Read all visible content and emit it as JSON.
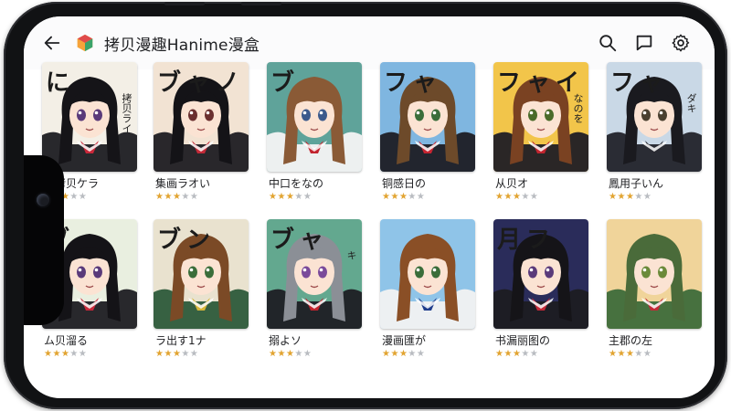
{
  "app": {
    "title": "拷贝漫趣Hanime漫盒",
    "icons": {
      "back": "arrow-left-icon",
      "logo": "cube-logo-icon",
      "search": "search-icon",
      "feedback": "feedback-icon",
      "settings": "gear-icon"
    }
  },
  "colors": {
    "star_on": "#e2a431",
    "star_off": "#b9bcc1"
  },
  "comics": [
    {
      "title": "栫拷贝ケラ",
      "rating": 3,
      "cover_text": "に",
      "side_text": "拷贝ライ",
      "bg": "#f3efe6",
      "hair": "#151418",
      "eyes": "#5a3a7a",
      "outfit": "#1c1c22",
      "accent": "#c9283a"
    },
    {
      "title": "集画ラオい",
      "rating": 3,
      "cover_text": "ブャノ",
      "side_text": "",
      "bg": "#f2e3d3",
      "hair": "#141317",
      "eyes": "#6b2f2f",
      "outfit": "#1e1c22",
      "accent": "#c32a38"
    },
    {
      "title": "中口をなの",
      "rating": 3,
      "cover_text": "ブ",
      "side_text": "",
      "bg": "#5fa39a",
      "hair": "#8a5a36",
      "eyes": "#3c5a8c",
      "outfit": "#f4f4f4",
      "accent": "#c2252f"
    },
    {
      "title": "铜感日の",
      "rating": 3,
      "cover_text": "フャ",
      "side_text": "",
      "bg": "#7fb6e0",
      "hair": "#6d4a2a",
      "eyes": "#3a6d3a",
      "outfit": "#1d1e24",
      "accent": "#c52531"
    },
    {
      "title": "从贝オ",
      "rating": 3,
      "cover_text": "フャイ",
      "side_text": "なのを",
      "bg": "#f2c54a",
      "hair": "#7a4222",
      "eyes": "#4a6b2a",
      "outfit": "#1f1e24",
      "accent": "#c2252f"
    },
    {
      "title": "鳳用子いん",
      "rating": 3,
      "cover_text": "フャ",
      "side_text": "ダキ",
      "bg": "#c9d8e6",
      "hair": "#1a1a1f",
      "eyes": "#4a4030",
      "outfit": "#22232a",
      "accent": "#2a2b33"
    },
    {
      "title": "ム贝溜る",
      "rating": 3,
      "cover_text": "ブ",
      "side_text": "",
      "bg": "#e9efe0",
      "hair": "#141317",
      "eyes": "#5a3a7a",
      "outfit": "#1d1c22",
      "accent": "#c9283a"
    },
    {
      "title": "ラ出す1ナ",
      "rating": 3,
      "cover_text": "ブン",
      "side_text": "",
      "bg": "#e9e2cf",
      "hair": "#7b4a26",
      "eyes": "#3a6d3a",
      "outfit": "#2d5a3a",
      "accent": "#d7b73a"
    },
    {
      "title": "搦よソ",
      "rating": 3,
      "cover_text": "ブャ",
      "side_text": "キ",
      "bg": "#63a88f",
      "hair": "#8b8f96",
      "eyes": "#7a4a9a",
      "outfit": "#1e1d24",
      "accent": "#c2252f"
    },
    {
      "title": "漫画匯が",
      "rating": 3,
      "cover_text": "",
      "side_text": "",
      "bg": "#8fc4e8",
      "hair": "#8a4f26",
      "eyes": "#3a6d3a",
      "outfit": "#f2f2f2",
      "accent": "#1f3d8c"
    },
    {
      "title": "书漏丽图の",
      "rating": 3,
      "cover_text": "月フ",
      "side_text": "",
      "bg": "#2a2c5a",
      "hair": "#151418",
      "eyes": "#5a3a7a",
      "outfit": "#1c1c22",
      "accent": "#c32a38"
    },
    {
      "title": "主郡の左",
      "rating": 3,
      "cover_text": "",
      "side_text": "",
      "bg": "#f0d49a",
      "hair": "#4a6b3a",
      "eyes": "#6b8a3a",
      "outfit": "#3d6b3a",
      "accent": "#c32a38"
    }
  ]
}
